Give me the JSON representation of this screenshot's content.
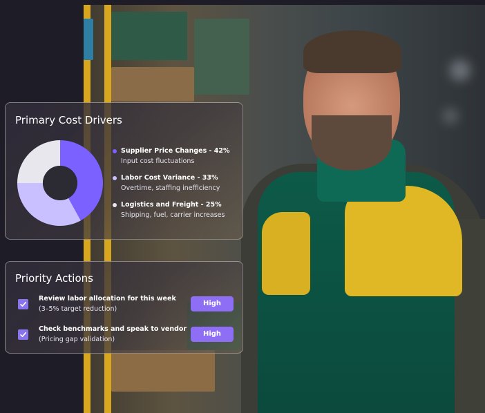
{
  "colors": {
    "accent": "#7b61ff",
    "secondary": "#c9c1ff",
    "tertiary": "#e9e7ee",
    "button": "#8d6ef5"
  },
  "cost_drivers": {
    "title": "Primary Cost Drivers",
    "items": [
      {
        "label": "Supplier Price Changes - 42%",
        "detail": "Input cost fluctuations",
        "percent": 42,
        "color": "#7b61ff"
      },
      {
        "label": "Labor Cost Variance - 33%",
        "detail": "Overtime, staffing inefficiency",
        "percent": 33,
        "color": "#c9c1ff"
      },
      {
        "label": "Logistics and Freight - 25%",
        "detail": "Shipping, fuel, carrier increases",
        "percent": 25,
        "color": "#e9e7ee"
      }
    ]
  },
  "chart_data": {
    "type": "pie",
    "categories": [
      "Supplier Price Changes",
      "Labor Cost Variance",
      "Logistics and Freight"
    ],
    "values": [
      42,
      33,
      25
    ],
    "title": "Primary Cost Drivers",
    "donut": true
  },
  "priority_actions": {
    "title": "Priority Actions",
    "items": [
      {
        "title": "Review labor allocation for this week",
        "detail": "(3–5% target reduction)",
        "priority": "High",
        "checked": true,
        "icon": "check-icon"
      },
      {
        "title": "Check benchmarks and speak to vendor",
        "detail": "(Pricing gap validation)",
        "priority": "High",
        "checked": true,
        "icon": "check-icon"
      }
    ]
  }
}
